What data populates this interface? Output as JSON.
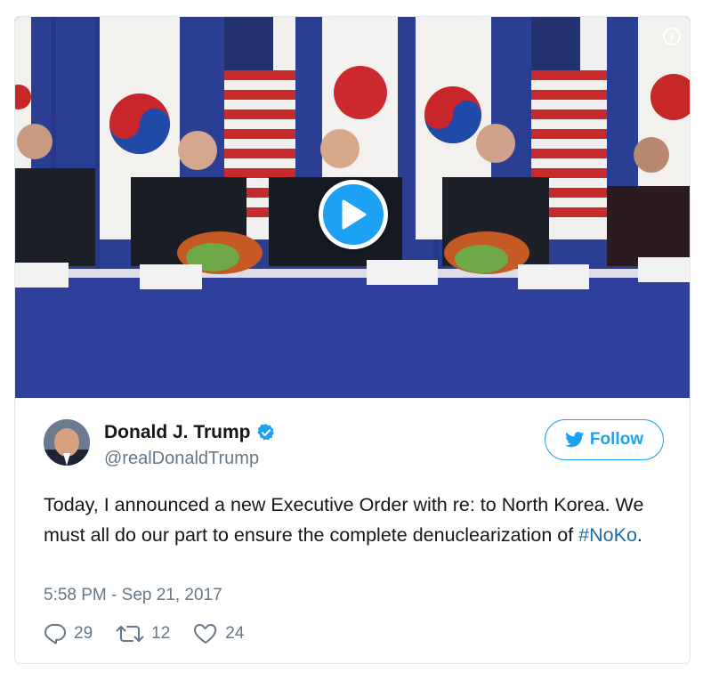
{
  "media": {
    "info_icon": "info-icon",
    "play_icon": "play-icon",
    "accent_color": "#1da1f2"
  },
  "author": {
    "display_name": "Donald J. Trump",
    "handle": "@realDonaldTrump",
    "verified": true,
    "verified_icon": "verified-badge-icon"
  },
  "follow_button": {
    "label": "Follow",
    "icon": "twitter-bird-icon"
  },
  "tweet": {
    "text_before": "Today, I announced a new Executive Order with re: to North Korea. We must all do our part to ensure the complete denuclearization of ",
    "hashtag": "#NoKo",
    "text_after": ".",
    "timestamp": "5:58 PM - Sep 21, 2017"
  },
  "actions": {
    "replies": "29",
    "retweets": "12",
    "likes": "24"
  },
  "colors": {
    "text": "#14171a",
    "secondary": "#657786",
    "link": "#1b6ea6",
    "brand": "#1da1f2",
    "border": "#e1e8ed"
  }
}
